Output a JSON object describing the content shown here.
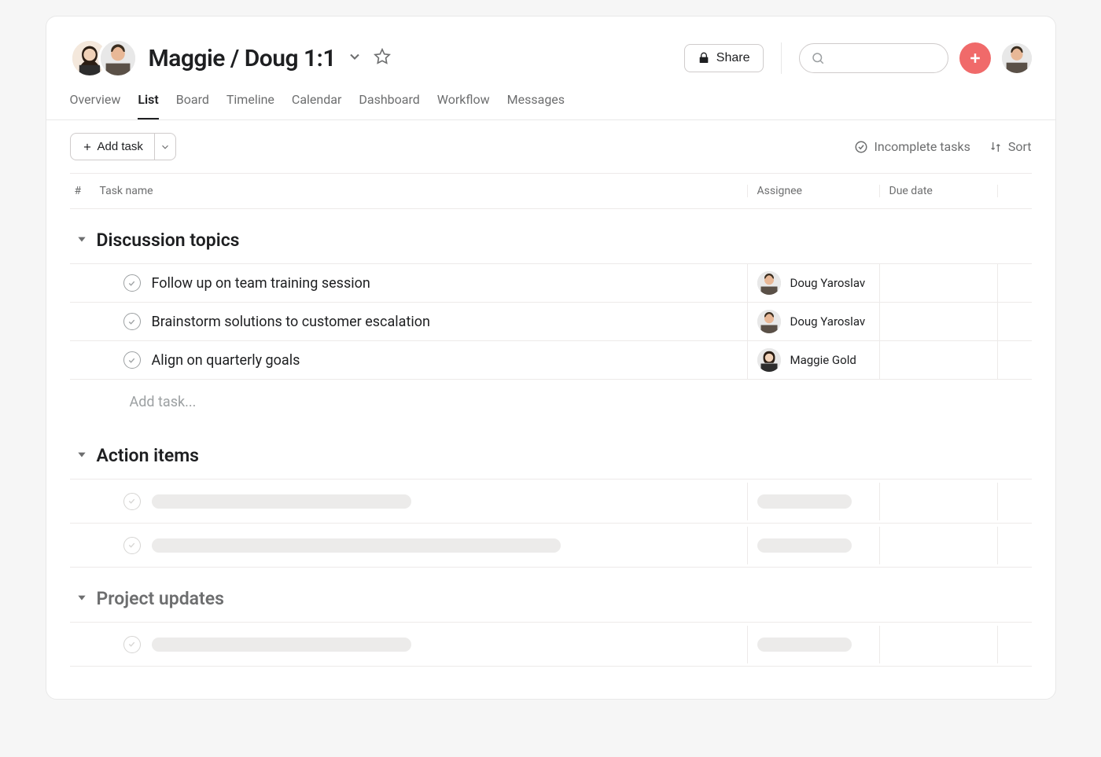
{
  "header": {
    "title": "Maggie / Doug 1:1",
    "share_label": "Share"
  },
  "tabs": [
    {
      "label": "Overview",
      "active": false
    },
    {
      "label": "List",
      "active": true
    },
    {
      "label": "Board",
      "active": false
    },
    {
      "label": "Timeline",
      "active": false
    },
    {
      "label": "Calendar",
      "active": false
    },
    {
      "label": "Dashboard",
      "active": false
    },
    {
      "label": "Workflow",
      "active": false
    },
    {
      "label": "Messages",
      "active": false
    }
  ],
  "toolbar": {
    "add_task_label": "Add task",
    "filter_label": "Incomplete tasks",
    "sort_label": "Sort"
  },
  "columns": {
    "hash": "#",
    "name": "Task name",
    "assignee": "Assignee",
    "due": "Due date"
  },
  "sections": [
    {
      "title": "Discussion topics",
      "muted": false,
      "tasks": [
        {
          "name": "Follow up on team training session",
          "assignee": "Doug Yaroslav",
          "avatar": "doug"
        },
        {
          "name": "Brainstorm solutions to customer escalation",
          "assignee": "Doug Yaroslav",
          "avatar": "doug"
        },
        {
          "name": "Align on quarterly goals",
          "assignee": "Maggie Gold",
          "avatar": "maggie"
        }
      ],
      "add_task_placeholder": "Add task..."
    },
    {
      "title": "Action items",
      "muted": false,
      "placeholder_tasks": [
        {
          "name_width": 330
        },
        {
          "name_width": 520
        }
      ]
    },
    {
      "title": "Project updates",
      "muted": true,
      "placeholder_tasks": [
        {
          "name_width": 330
        }
      ]
    }
  ],
  "avatars": {
    "doug": {
      "skin": "#e8b897",
      "hair": "#3a2d1f",
      "shirt": "#5a5047"
    },
    "maggie": {
      "skin": "#f1d2b8",
      "hair": "#2b1e14",
      "shirt": "#2d2d2d"
    }
  }
}
